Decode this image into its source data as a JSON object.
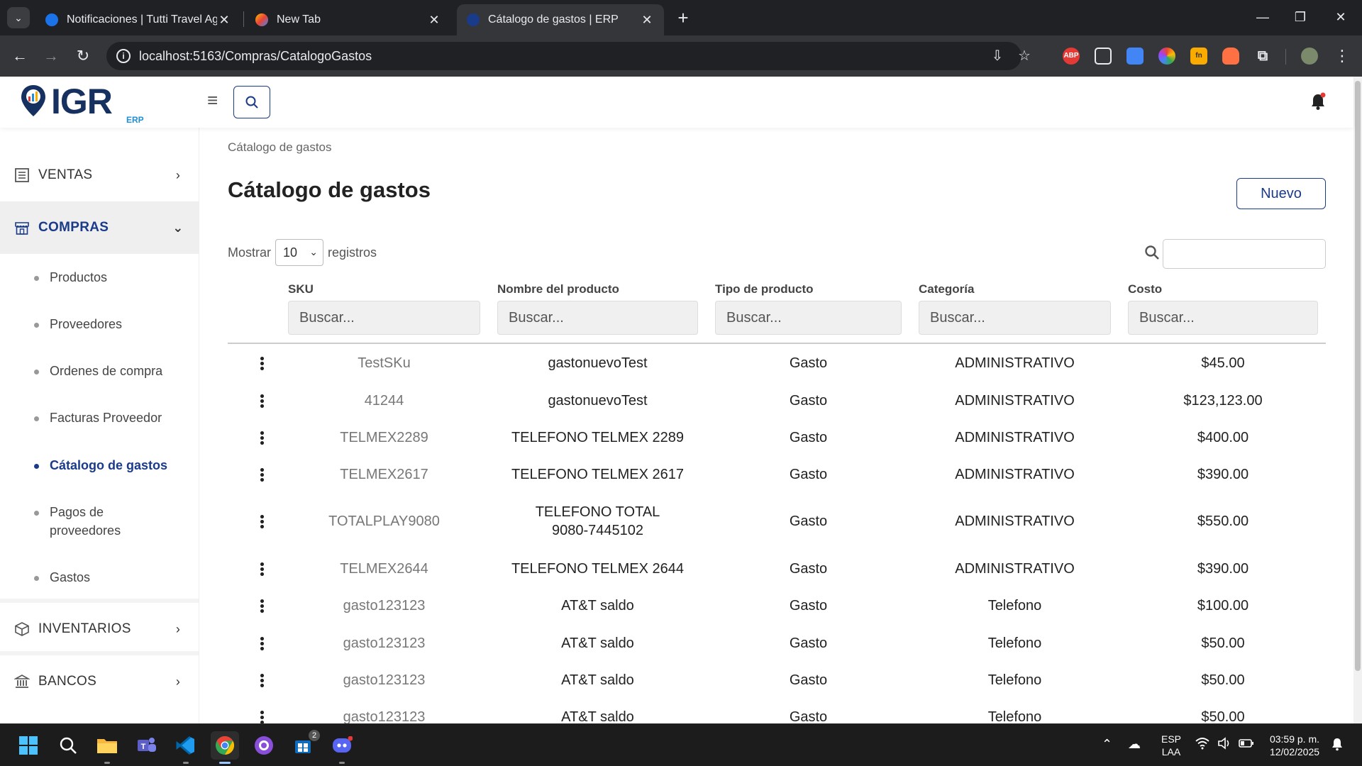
{
  "browser": {
    "tabs": [
      {
        "title": "Notificaciones | Tutti Travel Age",
        "active": false
      },
      {
        "title": "New Tab",
        "active": false
      },
      {
        "title": "Cátalogo de gastos | ERP",
        "active": true
      }
    ],
    "url": "localhost:5163/Compras/CatalogoGastos",
    "extensions": [
      "adblock-icon",
      "tab-icon",
      "docs-icon",
      "color-icon",
      "notes-icon",
      "fox-icon",
      "puzzle-icon",
      "profile-avatar"
    ]
  },
  "app": {
    "logo_text": "IGR",
    "logo_sub": "ERP",
    "accent": "#1a3a8a"
  },
  "sidebar": {
    "menus": [
      {
        "label": "VENTAS",
        "icon": "list-icon",
        "chevron": "›",
        "open": false
      },
      {
        "label": "COMPRAS",
        "icon": "store-icon",
        "chevron": "⌄",
        "open": true
      },
      {
        "label": "INVENTARIOS",
        "icon": "box-icon",
        "chevron": "›",
        "open": false
      },
      {
        "label": "BANCOS",
        "icon": "bank-icon",
        "chevron": "›",
        "open": false
      }
    ],
    "subitems": [
      {
        "label": "Productos",
        "active": false
      },
      {
        "label": "Proveedores",
        "active": false
      },
      {
        "label": "Ordenes de compra",
        "active": false
      },
      {
        "label": "Facturas Proveedor",
        "active": false
      },
      {
        "label": "Cátalogo de gastos",
        "active": true
      },
      {
        "label": "Pagos de proveedores",
        "active": false
      },
      {
        "label": "Gastos",
        "active": false
      }
    ]
  },
  "main": {
    "breadcrumb": "Cátalogo de gastos",
    "title": "Cátalogo de gastos",
    "new_button": "Nuevo",
    "show_prefix": "Mostrar",
    "show_value": "10",
    "show_suffix": "registros",
    "columns": [
      {
        "label": "SKU",
        "placeholder": "Buscar..."
      },
      {
        "label": "Nombre del producto",
        "placeholder": "Buscar..."
      },
      {
        "label": "Tipo de producto",
        "placeholder": "Buscar..."
      },
      {
        "label": "Categoría",
        "placeholder": "Buscar..."
      },
      {
        "label": "Costo",
        "placeholder": "Buscar..."
      }
    ],
    "rows": [
      {
        "sku": "TestSKu",
        "name": "gastonuevoTest",
        "type": "Gasto",
        "category": "ADMINISTRATIVO",
        "cost": "$45.00"
      },
      {
        "sku": "41244",
        "name": "gastonuevoTest",
        "type": "Gasto",
        "category": "ADMINISTRATIVO",
        "cost": "$123,123.00"
      },
      {
        "sku": "TELMEX2289",
        "name": "TELEFONO TELMEX 2289",
        "type": "Gasto",
        "category": "ADMINISTRATIVO",
        "cost": "$400.00"
      },
      {
        "sku": "TELMEX2617",
        "name": "TELEFONO TELMEX 2617",
        "type": "Gasto",
        "category": "ADMINISTRATIVO",
        "cost": "$390.00"
      },
      {
        "sku": "TOTALPLAY9080",
        "name": "TELEFONO TOTAL 9080-7445102",
        "type": "Gasto",
        "category": "ADMINISTRATIVO",
        "cost": "$550.00"
      },
      {
        "sku": "TELMEX2644",
        "name": "TELEFONO TELMEX 2644",
        "type": "Gasto",
        "category": "ADMINISTRATIVO",
        "cost": "$390.00"
      },
      {
        "sku": "gasto123123",
        "name": "AT&T saldo",
        "type": "Gasto",
        "category": "Telefono",
        "cost": "$100.00"
      },
      {
        "sku": "gasto123123",
        "name": "AT&T saldo",
        "type": "Gasto",
        "category": "Telefono",
        "cost": "$50.00"
      },
      {
        "sku": "gasto123123",
        "name": "AT&T saldo",
        "type": "Gasto",
        "category": "Telefono",
        "cost": "$50.00"
      },
      {
        "sku": "gasto123123",
        "name": "AT&T saldo",
        "type": "Gasto",
        "category": "Telefono",
        "cost": "$50.00"
      }
    ]
  },
  "taskbar": {
    "apps": [
      "windows-start-icon",
      "search-icon",
      "file-explorer-icon",
      "teams-icon",
      "vscode-icon",
      "chrome-icon",
      "github-desktop-icon",
      "store-icon",
      "discord-icon"
    ],
    "store_badge": "2",
    "lang_top": "ESP",
    "lang_bottom": "LAA",
    "time": "03:59 p. m.",
    "date": "12/02/2025"
  }
}
